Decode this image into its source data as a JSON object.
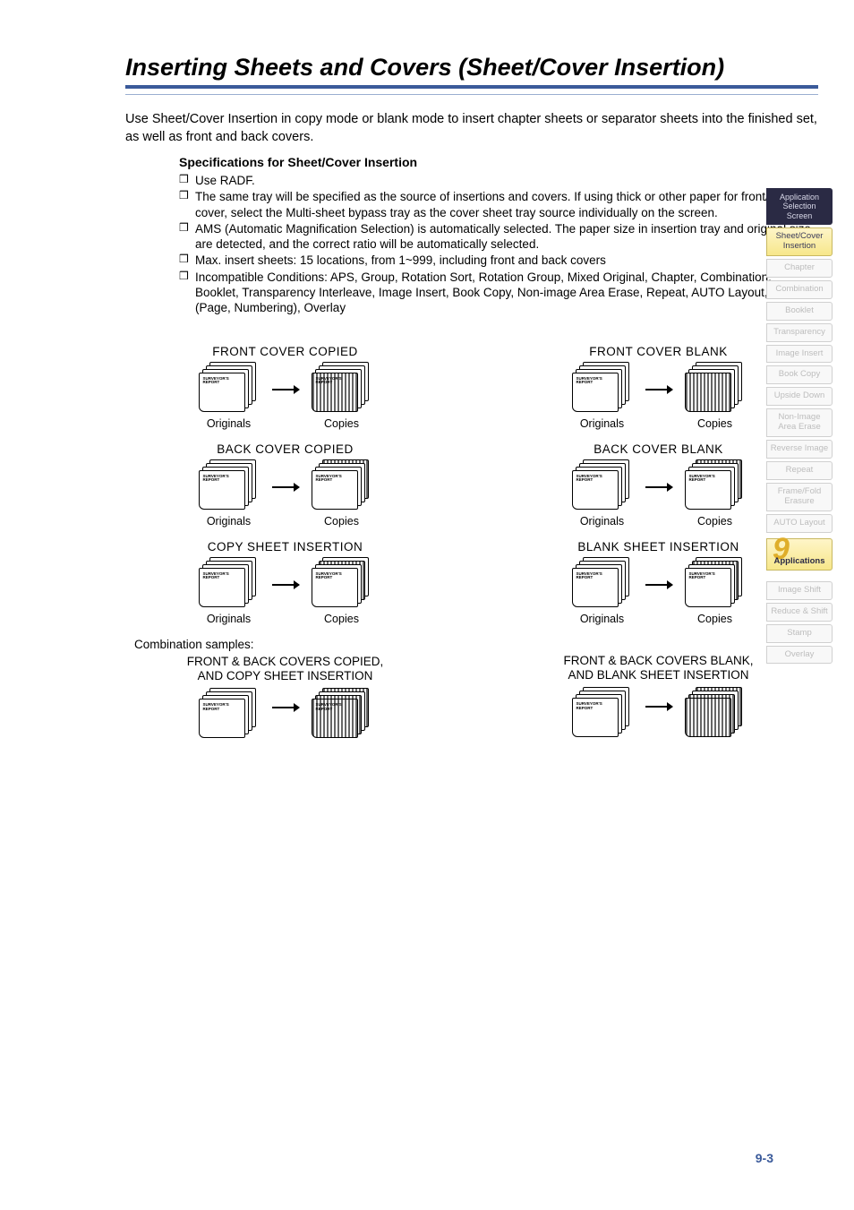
{
  "title": "Inserting Sheets and Covers (Sheet/Cover Insertion)",
  "intro": "Use Sheet/Cover Insertion in copy mode or blank mode to insert chapter sheets or separator sheets into the finished set, as well as front and back covers.",
  "specs_title": "Specifications for Sheet/Cover Insertion",
  "specs": [
    "Use RADF.",
    "The same tray will be specified as the source of insertions and covers. If using thick or other paper for front/back cover, select the Multi-sheet bypass tray as the cover sheet tray source individually on the screen.",
    "AMS (Automatic Magnification Selection) is automatically selected. The paper size in insertion tray and original size are detected, and the correct ratio will be automatically selected.",
    "Max. insert sheets: 15 locations, from 1~999, including front and back covers",
    "Incompatible Conditions: APS, Group, Rotation Sort, Rotation Group, Mixed Original, Chapter, Combination, Booklet, Transparency Interleave, Image Insert, Book Copy, Non-image Area Erase, Repeat, AUTO Layout, Stamp (Page, Numbering), Overlay"
  ],
  "diagrams": {
    "col1": [
      {
        "title": "FRONT COVER COPIED",
        "origLabel": "Originals",
        "copyLabel": "Copies"
      },
      {
        "title": "BACK COVER COPIED",
        "origLabel": "Originals",
        "copyLabel": "Copies"
      },
      {
        "title": "COPY SHEET INSERTION",
        "origLabel": "Originals",
        "copyLabel": "Copies"
      }
    ],
    "col2": [
      {
        "title": "FRONT COVER BLANK",
        "origLabel": "Originals",
        "copyLabel": "Copies"
      },
      {
        "title": "BACK COVER BLANK",
        "origLabel": "Originals",
        "copyLabel": "Copies"
      },
      {
        "title": "BLANK SHEET INSERTION",
        "origLabel": "Originals",
        "copyLabel": "Copies"
      }
    ],
    "comboLabel": "Combination samples:",
    "combo1": "FRONT & BACK COVERS COPIED,\nAND COPY SHEET INSERTION",
    "combo2": "FRONT & BACK COVERS BLANK,\nAND BLANK SHEET INSERTION",
    "sheetText": "SURVEYOR'S\nREPORT"
  },
  "tabs": [
    {
      "label": "Application Selection Screen",
      "cls": "dark small"
    },
    {
      "label": "Sheet/Cover Insertion",
      "cls": "active"
    },
    {
      "label": "Chapter",
      "cls": ""
    },
    {
      "label": "Combination",
      "cls": ""
    },
    {
      "label": "Booklet",
      "cls": ""
    },
    {
      "label": "Transparency",
      "cls": ""
    },
    {
      "label": "Image Insert",
      "cls": ""
    },
    {
      "label": "Book Copy",
      "cls": ""
    },
    {
      "label": "Upside Down",
      "cls": ""
    },
    {
      "label": "Non-Image Area Erase",
      "cls": ""
    },
    {
      "label": "Reverse Image",
      "cls": ""
    },
    {
      "label": "Repeat",
      "cls": ""
    },
    {
      "label": "Frame/Fold Erasure",
      "cls": ""
    },
    {
      "label": "AUTO Layout",
      "cls": ""
    }
  ],
  "section9": {
    "num": "9",
    "label": "Applications"
  },
  "tabs2": [
    {
      "label": "Image Shift",
      "cls": ""
    },
    {
      "label": "Reduce & Shift",
      "cls": ""
    },
    {
      "label": "Stamp",
      "cls": ""
    },
    {
      "label": "Overlay",
      "cls": ""
    }
  ],
  "pagenum": "9-3"
}
